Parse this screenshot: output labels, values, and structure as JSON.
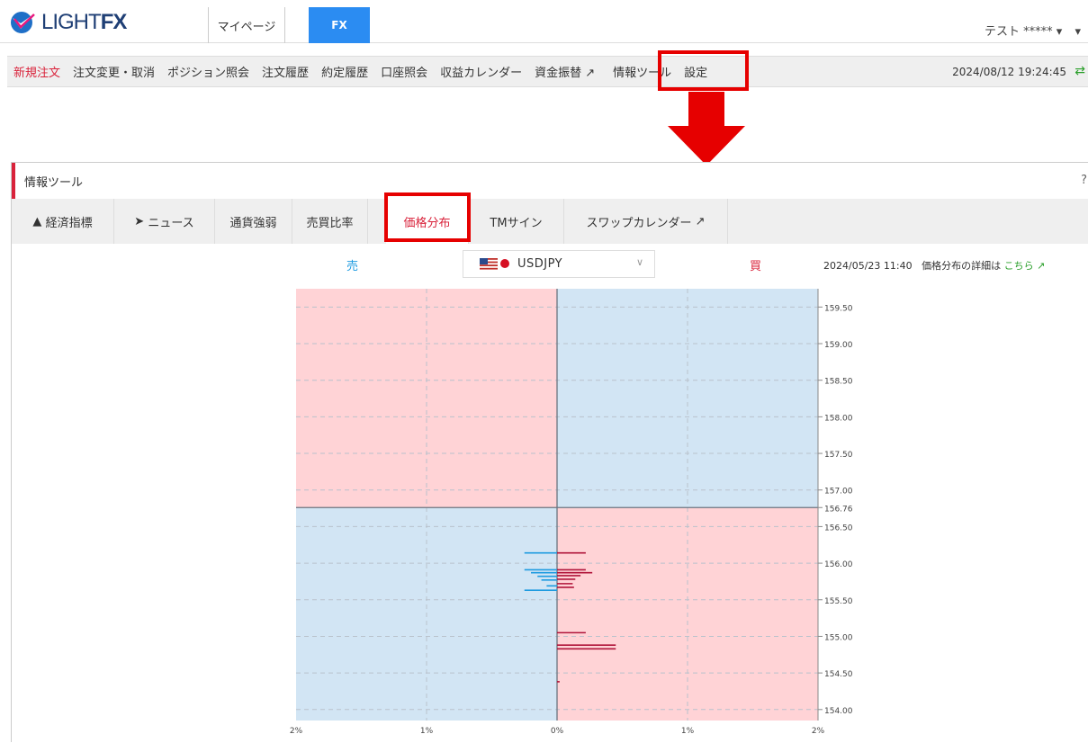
{
  "logo": {
    "text_light": "LIGHT",
    "text_bold": "FX"
  },
  "top_tabs": {
    "mypage": "マイページ",
    "fx": "FX"
  },
  "user": {
    "name": "テスト *****",
    "caret": "▾"
  },
  "nav": {
    "items": [
      "新規注文",
      "注文変更・取消",
      "ポジション照会",
      "注文履歴",
      "約定履歴",
      "口座照会",
      "収益カレンダー",
      "資金振替",
      "情報ツール",
      "設定"
    ],
    "clock": "2024/08/12 19:24:45"
  },
  "panel": {
    "title": "情報ツール",
    "help": "?",
    "tabs": [
      "経済指標",
      "ニュース",
      "通貨強弱",
      "売買比率",
      "価格分布",
      "TMサイン",
      "スワップカレンダー"
    ],
    "active_tab": "価格分布"
  },
  "chart_header": {
    "sell_label": "売",
    "buy_label": "買",
    "pair": "USDJPY",
    "datetime": "2024/05/23 11:40",
    "detail_text": "価格分布の詳細は",
    "detail_link": "こちら"
  },
  "colors": {
    "accent_red": "#d9233b",
    "sell_blue": "#1e9be0",
    "buy_red": "#b0143a",
    "zone_pink": "#ffd3d6",
    "zone_blue": "#d2e5f4",
    "brand_blue": "#2b8cf2",
    "link_green": "#2ca02c"
  },
  "chart_data": {
    "type": "bar",
    "orientation": "horizontal",
    "current_price": 156.76,
    "y_ticks": [
      "159.50",
      "159.00",
      "158.50",
      "158.00",
      "157.50",
      "157.00",
      "156.76",
      "156.50",
      "156.00",
      "155.50",
      "155.00",
      "154.50",
      "154.00"
    ],
    "x_ticks": [
      "2%",
      "1%",
      "0%",
      "1%",
      "2%"
    ],
    "ylim": [
      153.85,
      159.75
    ],
    "xlim": [
      -2,
      2
    ],
    "series": [
      {
        "side": "sell",
        "points": [
          {
            "price": 156.14,
            "percent": 0.25
          },
          {
            "price": 155.91,
            "percent": 0.25
          },
          {
            "price": 155.87,
            "percent": 0.2
          },
          {
            "price": 155.82,
            "percent": 0.15
          },
          {
            "price": 155.77,
            "percent": 0.12
          },
          {
            "price": 155.69,
            "percent": 0.08
          },
          {
            "price": 155.63,
            "percent": 0.25
          }
        ]
      },
      {
        "side": "buy",
        "points": [
          {
            "price": 156.14,
            "percent": 0.22
          },
          {
            "price": 155.91,
            "percent": 0.22
          },
          {
            "price": 155.87,
            "percent": 0.27
          },
          {
            "price": 155.83,
            "percent": 0.18
          },
          {
            "price": 155.78,
            "percent": 0.14
          },
          {
            "price": 155.72,
            "percent": 0.12
          },
          {
            "price": 155.67,
            "percent": 0.13
          },
          {
            "price": 155.05,
            "percent": 0.22
          },
          {
            "price": 154.88,
            "percent": 0.45
          },
          {
            "price": 154.83,
            "percent": 0.45
          },
          {
            "price": 154.38,
            "percent": 0.02
          }
        ]
      }
    ]
  }
}
